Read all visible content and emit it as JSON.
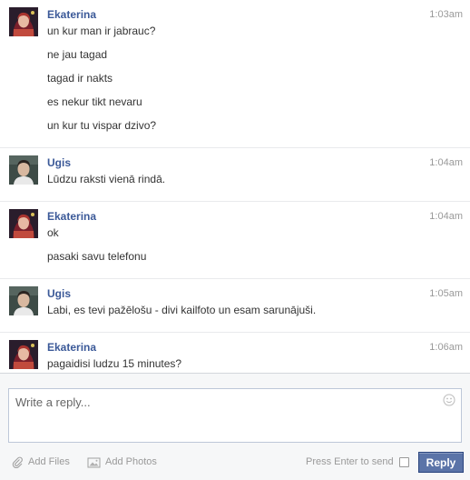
{
  "thread": [
    {
      "sender": "Ekaterina",
      "time": "1:03am",
      "avatar": "female-avatar",
      "messages": [
        "un kur man ir jabrauc?",
        "ne jau tagad",
        "tagad ir nakts",
        "es nekur tikt nevaru",
        "un kur tu vispar dzivo?"
      ]
    },
    {
      "sender": "Ugis",
      "time": "1:04am",
      "avatar": "male-avatar",
      "messages": [
        "Lūdzu raksti vienā rindā."
      ]
    },
    {
      "sender": "Ekaterina",
      "time": "1:04am",
      "avatar": "female-avatar",
      "messages": [
        "ok",
        "pasaki savu telefonu"
      ]
    },
    {
      "sender": "Ugis",
      "time": "1:05am",
      "avatar": "male-avatar",
      "messages": [
        "Labi, es tevi pažēlošu - divi kailfoto un esam sarunājuši."
      ]
    },
    {
      "sender": "Ekaterina",
      "time": "1:06am",
      "avatar": "female-avatar",
      "messages": [
        "pagaidisi ludzu 15 minutes?"
      ]
    }
  ],
  "composer": {
    "placeholder": "Write a reply...",
    "add_files": "Add Files",
    "add_photos": "Add Photos",
    "press_enter": "Press Enter to send",
    "reply_label": "Reply",
    "icons": {
      "emoji": "smiley-icon",
      "files": "paperclip-icon",
      "photos": "camera-icon"
    }
  },
  "colors": {
    "sender_name": "#3b5998",
    "reply_button": "#5b74a8",
    "timestamp": "#999999"
  }
}
